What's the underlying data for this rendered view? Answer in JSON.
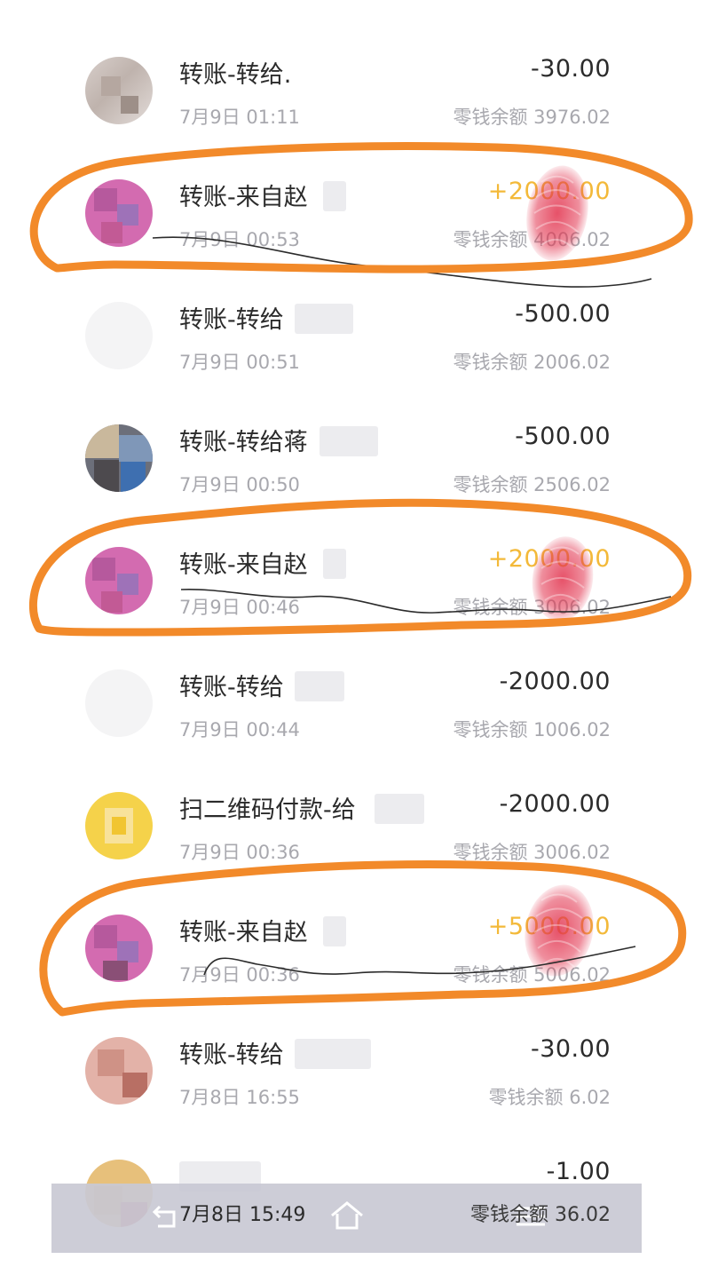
{
  "transactions": [
    {
      "title": "转账-转给.",
      "time": "7月9日 01:11",
      "amount": "-30.00",
      "balance": "零钱余额 3976.02"
    },
    {
      "title": "转账-来自赵",
      "time": "7月9日 00:53",
      "amount": "+2000.00",
      "balance": "零钱余额 4006.02"
    },
    {
      "title": "转账-转给",
      "time": "7月9日 00:51",
      "amount": "-500.00",
      "balance": "零钱余额 2006.02"
    },
    {
      "title": "转账-转给蒋",
      "time": "7月9日 00:50",
      "amount": "-500.00",
      "balance": "零钱余额 2506.02"
    },
    {
      "title": "转账-来自赵",
      "time": "7月9日 00:46",
      "amount": "+2000.00",
      "balance": "零钱余额 3006.02"
    },
    {
      "title": "转账-转给",
      "time": "7月9日 00:44",
      "amount": "-2000.00",
      "balance": "零钱余额 1006.02"
    },
    {
      "title": "扫二维码付款-给",
      "time": "7月9日 00:36",
      "amount": "-2000.00",
      "balance": "零钱余额 3006.02"
    },
    {
      "title": "转账-来自赵",
      "time": "7月9日 00:36",
      "amount": "+5000.00",
      "balance": "零钱余额 5006.02"
    },
    {
      "title": "转账-转给",
      "time": "7月8日 16:55",
      "amount": "-30.00",
      "balance": "零钱余额 6.02"
    },
    {
      "title": "",
      "time": "7月8日 15:49",
      "amount": "-1.00",
      "balance": "零钱余额 36.02"
    }
  ],
  "colors": {
    "income": "#f3b939",
    "highlight": "#f28a2a",
    "fingerprint": "#e2334e"
  },
  "nav": {
    "back_icon": "back-icon",
    "home_icon": "home-icon",
    "menu_icon": "menu-icon"
  }
}
